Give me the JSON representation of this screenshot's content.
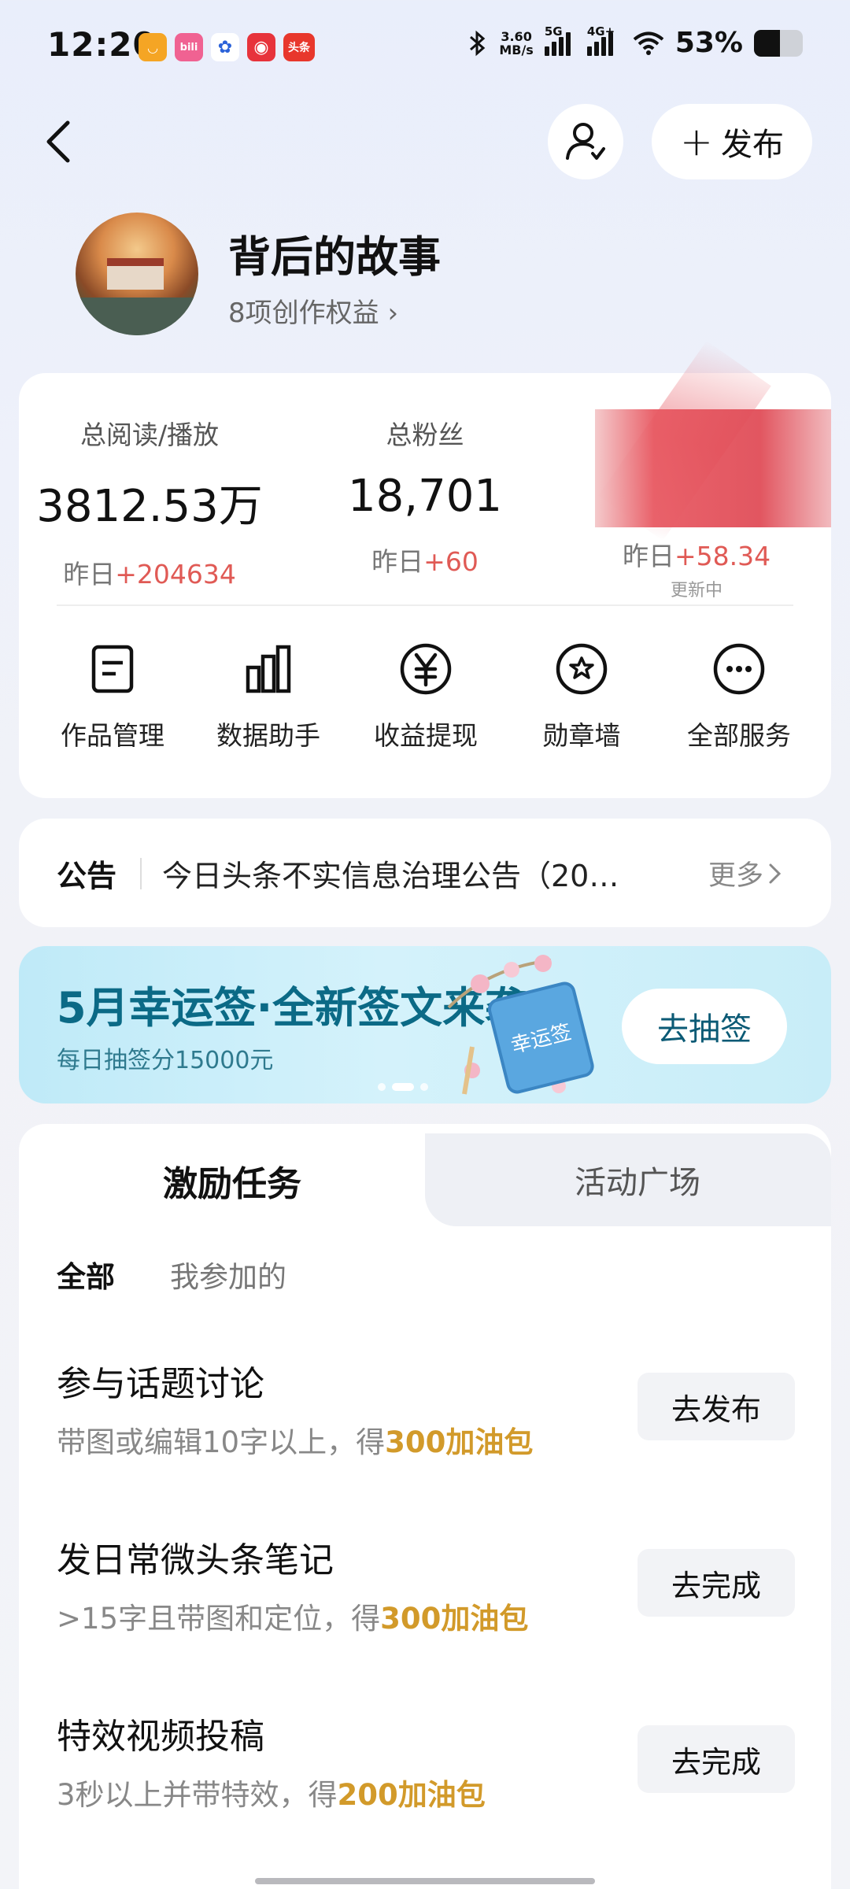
{
  "status_bar": {
    "time": "12:20",
    "net_speed_value": "3.60",
    "net_speed_unit": "MB/s",
    "network_1": "5G",
    "network_2": "4G+",
    "battery_percent": "53%",
    "battery_level": 0.53,
    "notification_icons": [
      "app-icon-orange",
      "bilibili-icon",
      "baidu-icon",
      "netease-music-icon",
      "toutiao-icon"
    ],
    "toutiao_icon_text": "头条"
  },
  "header": {
    "publish_label": "发布"
  },
  "profile": {
    "name": "背后的故事",
    "rights": "8项创作权益 ›"
  },
  "stats": [
    {
      "label": "总阅读/播放",
      "value": "3812.53万",
      "delta_prefix": "昨日",
      "delta": "+204634"
    },
    {
      "label": "总粉丝",
      "value": "18,701",
      "delta_prefix": "昨日",
      "delta": "+60"
    },
    {
      "label": "",
      "value": "",
      "delta_prefix": "昨日",
      "delta": "+58.34",
      "note": "更新中"
    }
  ],
  "services": [
    {
      "label": "作品管理",
      "icon": "document-icon"
    },
    {
      "label": "数据助手",
      "icon": "bar-chart-icon"
    },
    {
      "label": "收益提现",
      "icon": "yen-icon"
    },
    {
      "label": "勋章墙",
      "icon": "medal-icon"
    },
    {
      "label": "全部服务",
      "icon": "more-icon"
    }
  ],
  "notice": {
    "title": "公告",
    "text": "今日头条不实信息治理公告（20…",
    "more": "更多"
  },
  "banner": {
    "title": "5月幸运签·全新签文来袭",
    "subtitle": "每日抽签分15000元",
    "button": "去抽签",
    "deco_text": "幸运签"
  },
  "tasks": {
    "tabs": [
      "激励任务",
      "活动广场"
    ],
    "filters": [
      "全部",
      "我参加的"
    ],
    "items": [
      {
        "title": "参与话题讨论",
        "desc": "带图或编辑10字以上，得",
        "reward": "300加油包",
        "button": "去发布"
      },
      {
        "title": "发日常微头条笔记",
        "desc": ">15字且带图和定位，得",
        "reward": "300加油包",
        "button": "去完成"
      },
      {
        "title": "特效视频投稿",
        "desc": "3秒以上并带特效，得",
        "reward": "200加油包",
        "button": "去完成"
      }
    ]
  },
  "colors": {
    "accent_red": "#e05a55",
    "reward_gold": "#d29a2a",
    "banner_title": "#0b6a86"
  }
}
